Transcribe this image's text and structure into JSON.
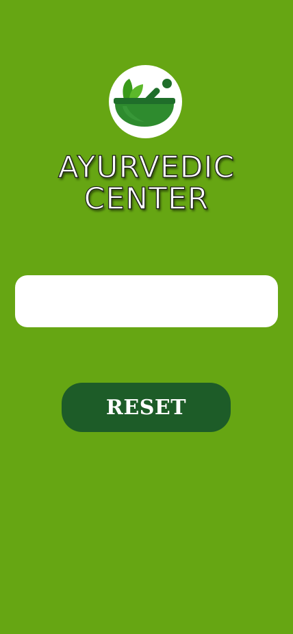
{
  "app": {
    "title_line1": "AYURVEDIC",
    "title_line2": "CENTER"
  },
  "logo": {
    "icon": "mortar-pestle-leaves-icon"
  },
  "form": {
    "input_value": "",
    "input_placeholder": "",
    "reset_label": "RESET"
  },
  "colors": {
    "background": "#66a613",
    "button": "#1d5c28",
    "logo_bowl": "#2e8b2e",
    "logo_leaf": "#3a9a1a"
  }
}
